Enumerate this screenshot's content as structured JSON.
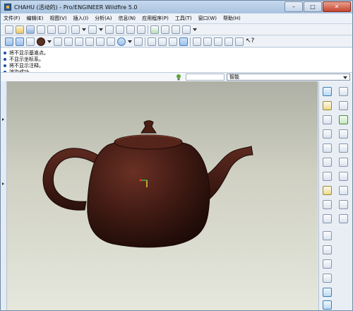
{
  "window": {
    "title": "CHAHU (活动的) - Pro/ENGINEER Wildfire 5.0"
  },
  "menu": [
    "文件(F)",
    "编辑(E)",
    "视图(V)",
    "插入(I)",
    "分析(A)",
    "信息(N)",
    "应用程序(P)",
    "工具(T)",
    "窗口(W)",
    "帮助(H)"
  ],
  "messages": [
    "将不显示基准点。",
    "不显示坐标系。",
    "将不显示注释。",
    "渲染成功"
  ],
  "filter": {
    "selected": "智能"
  },
  "colors": {
    "teapot": "#4a1f16",
    "accent": "#1a4fa6"
  },
  "icons": [
    "app-icon",
    "new-file-icon",
    "open-icon",
    "save-icon",
    "print-icon",
    "undo-icon",
    "redo-icon",
    "cut-icon",
    "copy-icon",
    "paste-icon",
    "regenerate-icon",
    "search-icon",
    "select-box-icon",
    "zoom-in-icon",
    "zoom-out-icon",
    "refit-icon",
    "shading-icon",
    "datum-plane-icon",
    "datum-axis-icon",
    "datum-point-icon",
    "csys-icon",
    "context-help-icon",
    "sketch-icon",
    "extrude-icon",
    "revolve-icon",
    "hole-icon",
    "round-icon",
    "mirror-icon",
    "pattern-icon"
  ]
}
